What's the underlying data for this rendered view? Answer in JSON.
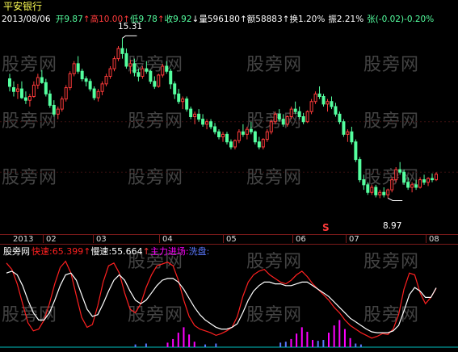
{
  "stock_name": "平安银行",
  "info": {
    "date": "2013/08/06",
    "open_label": "开",
    "open": "9.87",
    "high_label": "高",
    "high": "10.00",
    "low_label": "低",
    "low": "9.78",
    "close_label": "收",
    "close": "9.92",
    "volume_label": "量",
    "volume": "596180",
    "amount_label": "额",
    "amount": "58883",
    "turnover_label": "换",
    "turnover": "1.20%",
    "amplitude_label": "振",
    "amplitude": "2.21%",
    "change_label": "张",
    "change": "(-0.02)-0.20%"
  },
  "watermark": "股旁网",
  "price_annotations": {
    "high": "15.31",
    "low": "8.97"
  },
  "signal_mark": "S",
  "time_axis": {
    "labels": [
      "2013",
      "02",
      "03",
      "04",
      "05",
      "06",
      "07",
      "08"
    ]
  },
  "indicator": {
    "name": "股旁网",
    "fast_label": "快速",
    "fast_value": "65.399",
    "slow_label": "慢速",
    "slow_value": "55.664",
    "inflow_label": "主力进场",
    "wash_label": "洗盘"
  },
  "colors": {
    "background": "#000000",
    "up_candle": "#ff3b3b",
    "down_candle": "#54ff9f",
    "fast_line": "#ff2020",
    "slow_line": "#ffffff",
    "inflow_bar": "#ff00ff",
    "wash_bar": "#5a78ff",
    "baseline": "#00c0c0"
  },
  "chart_data": [
    {
      "type": "candlestick",
      "title": "平安银行",
      "x_unit": "trading day",
      "y_unit": "price",
      "ylim": [
        7.8,
        15.8
      ],
      "ohlc": [
        [
          13.7,
          13.9,
          13.2,
          13.4
        ],
        [
          13.35,
          13.6,
          13.0,
          13.2
        ],
        [
          13.2,
          13.5,
          12.9,
          13.3
        ],
        [
          13.3,
          13.6,
          12.9,
          12.95
        ],
        [
          12.95,
          13.2,
          12.7,
          12.85
        ],
        [
          12.85,
          13.1,
          12.6,
          13.0
        ],
        [
          13.0,
          13.6,
          12.95,
          13.45
        ],
        [
          13.45,
          13.9,
          13.3,
          13.75
        ],
        [
          13.75,
          14.05,
          13.5,
          13.55
        ],
        [
          13.55,
          13.7,
          13.0,
          13.1
        ],
        [
          13.1,
          13.25,
          12.55,
          12.65
        ],
        [
          12.65,
          12.85,
          12.2,
          12.3
        ],
        [
          12.3,
          12.6,
          12.1,
          12.5
        ],
        [
          12.5,
          13.0,
          12.4,
          12.9
        ],
        [
          12.9,
          13.45,
          12.8,
          13.35
        ],
        [
          13.35,
          14.0,
          13.25,
          13.9
        ],
        [
          13.9,
          14.4,
          13.8,
          14.3
        ],
        [
          14.3,
          14.6,
          13.9,
          14.0
        ],
        [
          14.0,
          14.1,
          13.6,
          13.7
        ],
        [
          13.7,
          13.8,
          13.4,
          13.6
        ],
        [
          13.6,
          13.7,
          13.2,
          13.3
        ],
        [
          13.3,
          13.4,
          12.85,
          12.95
        ],
        [
          12.95,
          13.3,
          12.8,
          13.2
        ],
        [
          13.2,
          13.6,
          13.05,
          13.5
        ],
        [
          13.5,
          13.9,
          13.4,
          13.8
        ],
        [
          13.8,
          14.2,
          13.7,
          14.1
        ],
        [
          14.1,
          14.6,
          14.0,
          14.5
        ],
        [
          14.5,
          15.0,
          14.4,
          14.9
        ],
        [
          14.9,
          15.31,
          14.5,
          14.7
        ],
        [
          14.7,
          14.9,
          14.1,
          14.2
        ],
        [
          14.2,
          14.45,
          13.9,
          14.3
        ],
        [
          14.3,
          14.5,
          13.8,
          13.95
        ],
        [
          13.95,
          14.1,
          13.6,
          13.8
        ],
        [
          13.8,
          14.2,
          13.7,
          14.1
        ],
        [
          14.1,
          14.4,
          13.9,
          14.0
        ],
        [
          14.0,
          14.05,
          13.5,
          13.6
        ],
        [
          13.6,
          13.8,
          13.3,
          13.4
        ],
        [
          13.4,
          13.9,
          13.35,
          13.85
        ],
        [
          13.85,
          14.3,
          13.75,
          14.2
        ],
        [
          14.2,
          14.4,
          13.9,
          14.0
        ],
        [
          14.0,
          14.1,
          13.3,
          13.5
        ],
        [
          13.5,
          13.6,
          12.9,
          13.1
        ],
        [
          13.1,
          13.3,
          12.7,
          12.8
        ],
        [
          12.8,
          13.0,
          12.5,
          12.9
        ],
        [
          12.9,
          13.0,
          12.4,
          12.5
        ],
        [
          12.5,
          12.6,
          12.1,
          12.2
        ],
        [
          12.2,
          12.4,
          11.9,
          12.3
        ],
        [
          12.3,
          12.5,
          12.0,
          12.1
        ],
        [
          12.1,
          12.3,
          11.8,
          11.9
        ],
        [
          11.9,
          12.1,
          11.7,
          12.0
        ],
        [
          12.0,
          12.1,
          11.7,
          11.8
        ],
        [
          11.8,
          11.95,
          11.5,
          11.6
        ],
        [
          11.6,
          11.7,
          11.3,
          11.4
        ],
        [
          11.4,
          11.6,
          11.2,
          11.5
        ],
        [
          11.5,
          11.6,
          11.1,
          11.2
        ],
        [
          11.2,
          11.3,
          10.9,
          11.0
        ],
        [
          11.0,
          11.3,
          10.9,
          11.25
        ],
        [
          11.25,
          11.7,
          11.15,
          11.6
        ],
        [
          11.6,
          11.9,
          11.4,
          11.5
        ],
        [
          11.5,
          11.8,
          11.3,
          11.7
        ],
        [
          11.7,
          12.0,
          11.5,
          11.6
        ],
        [
          11.6,
          11.65,
          11.1,
          11.2
        ],
        [
          11.2,
          11.4,
          10.9,
          11.0
        ],
        [
          11.0,
          11.35,
          10.9,
          11.3
        ],
        [
          11.3,
          11.7,
          11.2,
          11.6
        ],
        [
          11.6,
          12.1,
          11.5,
          12.0
        ],
        [
          12.0,
          12.4,
          11.9,
          12.3
        ],
        [
          12.3,
          12.5,
          12.0,
          12.1
        ],
        [
          12.1,
          12.3,
          11.8,
          11.9
        ],
        [
          11.9,
          12.25,
          11.8,
          12.2
        ],
        [
          12.2,
          12.6,
          12.1,
          12.5
        ],
        [
          12.5,
          12.8,
          12.3,
          12.4
        ],
        [
          12.4,
          12.6,
          12.1,
          12.2
        ],
        [
          12.2,
          12.35,
          11.9,
          12.0
        ],
        [
          12.0,
          12.45,
          11.95,
          12.4
        ],
        [
          12.4,
          12.9,
          12.3,
          12.8
        ],
        [
          12.8,
          13.2,
          12.7,
          13.1
        ],
        [
          13.1,
          13.4,
          12.9,
          13.0
        ],
        [
          13.0,
          13.1,
          12.6,
          12.7
        ],
        [
          12.7,
          12.9,
          12.4,
          12.8
        ],
        [
          12.8,
          13.0,
          12.5,
          12.6
        ],
        [
          12.6,
          12.75,
          12.2,
          12.3
        ],
        [
          12.3,
          12.4,
          11.9,
          12.0
        ],
        [
          12.0,
          12.1,
          11.4,
          11.5
        ],
        [
          11.5,
          11.7,
          11.2,
          11.6
        ],
        [
          11.6,
          11.8,
          11.1,
          11.2
        ],
        [
          11.2,
          11.3,
          10.4,
          10.5
        ],
        [
          10.5,
          10.6,
          9.6,
          9.7
        ],
        [
          9.7,
          9.9,
          9.3,
          9.5
        ],
        [
          9.5,
          9.6,
          9.1,
          9.2
        ],
        [
          9.2,
          9.5,
          9.1,
          9.4
        ],
        [
          9.4,
          9.5,
          9.0,
          9.1
        ],
        [
          9.1,
          9.3,
          8.97,
          9.2
        ],
        [
          9.2,
          9.4,
          9.0,
          9.1
        ],
        [
          9.1,
          9.35,
          8.97,
          9.3
        ],
        [
          9.3,
          9.8,
          9.2,
          9.7
        ],
        [
          9.7,
          10.2,
          9.6,
          10.1
        ],
        [
          10.1,
          10.4,
          9.9,
          10.0
        ],
        [
          10.0,
          10.1,
          9.5,
          9.6
        ],
        [
          9.6,
          9.8,
          9.3,
          9.4
        ],
        [
          9.4,
          9.6,
          9.2,
          9.5
        ],
        [
          9.5,
          9.7,
          9.3,
          9.4
        ],
        [
          9.4,
          9.8,
          9.35,
          9.7
        ],
        [
          9.7,
          9.9,
          9.5,
          9.6
        ],
        [
          9.6,
          9.8,
          9.45,
          9.75
        ],
        [
          9.75,
          9.95,
          9.6,
          9.7
        ],
        [
          9.7,
          10.0,
          9.65,
          9.92
        ]
      ],
      "annotations": [
        {
          "label": "15.31",
          "value": 15.31
        },
        {
          "label": "8.97",
          "value": 8.97
        }
      ],
      "x_tick_labels": [
        "2013",
        "02",
        "03",
        "04",
        "05",
        "06",
        "07",
        "08"
      ]
    },
    {
      "type": "line",
      "title": "股旁网",
      "ylim": [
        0,
        100
      ],
      "series": [
        {
          "name": "快速",
          "values": [
            93,
            86,
            70,
            48,
            27,
            18,
            20,
            30,
            48,
            70,
            88,
            95,
            82,
            57,
            33,
            22,
            25,
            46,
            72,
            90,
            93,
            82,
            60,
            42,
            38,
            48,
            66,
            80,
            90,
            92,
            94,
            90,
            74,
            52,
            34,
            24,
            20,
            18,
            16,
            13,
            15,
            18,
            22,
            34,
            56,
            72,
            80,
            84,
            86,
            80,
            76,
            72,
            70,
            74,
            80,
            84,
            78,
            70,
            64,
            58,
            52,
            44,
            38,
            30,
            24,
            20,
            16,
            13,
            10,
            12,
            15,
            14,
            20,
            36,
            64,
            82,
            80,
            60,
            48,
            55,
            65
          ]
        },
        {
          "name": "慢速",
          "values": [
            82,
            84,
            80,
            68,
            52,
            38,
            30,
            30,
            38,
            52,
            68,
            80,
            82,
            74,
            58,
            42,
            34,
            36,
            48,
            62,
            74,
            80,
            74,
            62,
            52,
            48,
            52,
            60,
            68,
            74,
            76,
            76,
            72,
            64,
            54,
            44,
            36,
            30,
            26,
            22,
            20,
            20,
            22,
            26,
            38,
            52,
            62,
            68,
            72,
            72,
            70,
            70,
            68,
            68,
            70,
            72,
            72,
            68,
            64,
            60,
            56,
            50,
            44,
            38,
            32,
            28,
            24,
            20,
            17,
            16,
            16,
            16,
            18,
            24,
            40,
            58,
            66,
            62,
            55,
            55,
            65.664
          ]
        }
      ]
    },
    {
      "type": "bar",
      "series": [
        {
          "name": "主力进场",
          "bars": [
            {
              "x": 30,
              "value": 5
            },
            {
              "x": 31,
              "value": 9
            },
            {
              "x": 32,
              "value": 16
            },
            {
              "x": 33,
              "value": 22
            },
            {
              "x": 34,
              "value": 14
            },
            {
              "x": 35,
              "value": 6
            },
            {
              "x": 53,
              "value": 9
            },
            {
              "x": 54,
              "value": 15
            },
            {
              "x": 55,
              "value": 22
            },
            {
              "x": 56,
              "value": 17
            },
            {
              "x": 57,
              "value": 8
            },
            {
              "x": 60,
              "value": 16
            },
            {
              "x": 61,
              "value": 24
            },
            {
              "x": 62,
              "value": 30
            },
            {
              "x": 63,
              "value": 20
            },
            {
              "x": 64,
              "value": 10
            }
          ]
        },
        {
          "name": "洗盘",
          "bars": [
            {
              "x": 24,
              "value": 3
            },
            {
              "x": 26,
              "value": 4
            },
            {
              "x": 37,
              "value": 3
            },
            {
              "x": 39,
              "value": 4
            },
            {
              "x": 51,
              "value": 5
            },
            {
              "x": 52,
              "value": 6
            },
            {
              "x": 58,
              "value": 7
            },
            {
              "x": 59,
              "value": 8
            },
            {
              "x": 65,
              "value": 4
            },
            {
              "x": 66,
              "value": 3
            }
          ]
        }
      ]
    }
  ]
}
